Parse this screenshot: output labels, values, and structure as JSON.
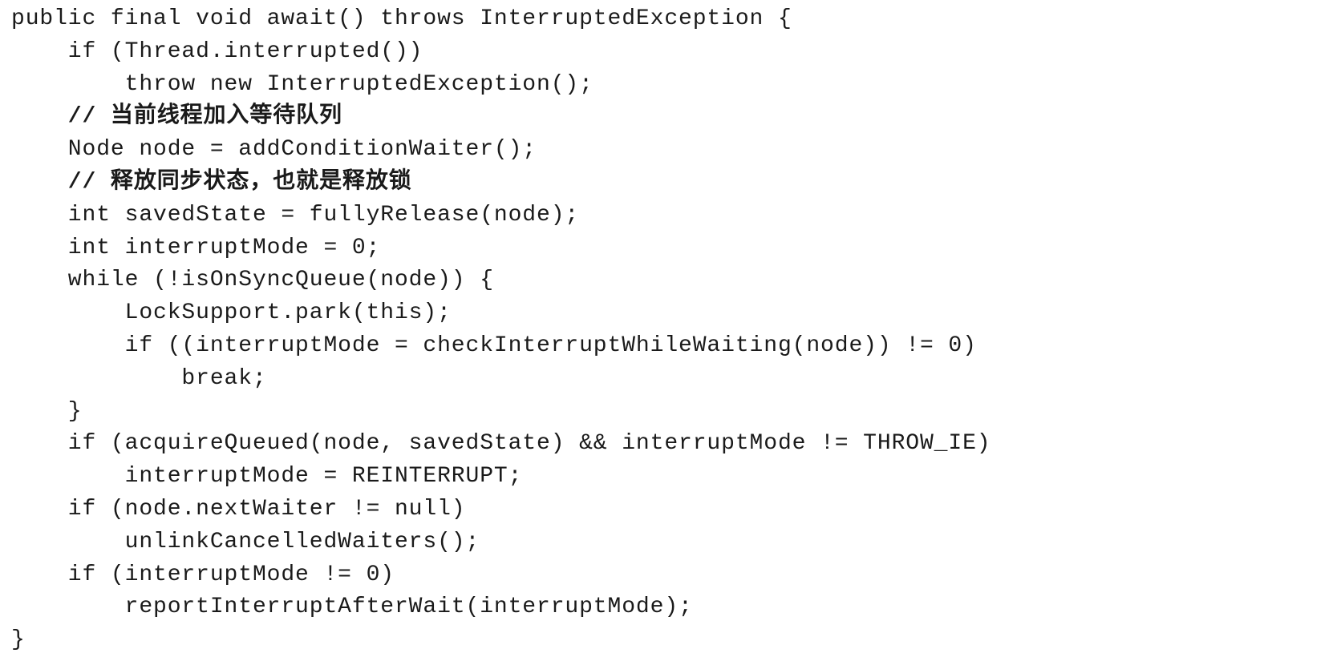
{
  "code": {
    "lines": [
      "public final void await() throws InterruptedException {",
      "    if (Thread.interrupted())",
      "        throw new InterruptedException();",
      "    // 当前线程加入等待队列",
      "    Node node = addConditionWaiter();",
      "    // 释放同步状态，也就是释放锁",
      "    int savedState = fullyRelease(node);",
      "    int interruptMode = 0;",
      "    while (!isOnSyncQueue(node)) {",
      "        LockSupport.park(this);",
      "        if ((interruptMode = checkInterruptWhileWaiting(node)) != 0)",
      "            break;",
      "    }",
      "    if (acquireQueued(node, savedState) && interruptMode != THROW_IE)",
      "        interruptMode = REINTERRUPT;",
      "    if (node.nextWaiter != null)",
      "        unlinkCancelledWaiters();",
      "    if (interruptMode != 0)",
      "        reportInterruptAfterWait(interruptMode);",
      "}"
    ]
  }
}
